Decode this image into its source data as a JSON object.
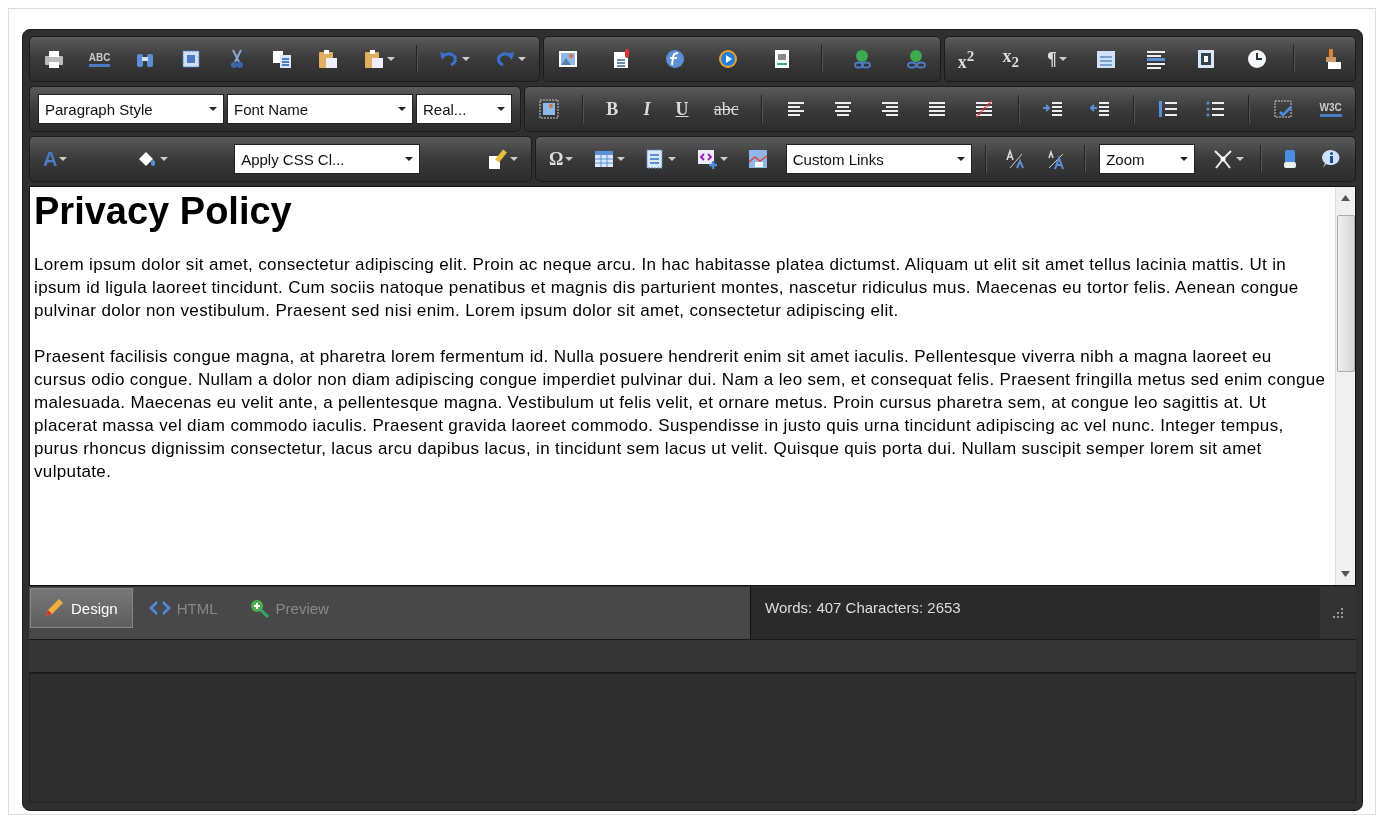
{
  "toolbars": [
    [
      [
        {
          "kind": "icon",
          "menu": false
        },
        {
          "kind": "glyph",
          "text": "ABC",
          "menu": false
        },
        {
          "kind": "icon",
          "menu": false
        },
        {
          "kind": "icon",
          "menu": false
        },
        {
          "kind": "icon",
          "menu": false
        },
        {
          "kind": "icon",
          "menu": false
        },
        {
          "kind": "icon",
          "menu": false
        },
        {
          "kind": "icon",
          "menu": true
        },
        {
          "kind": "sep"
        },
        {
          "kind": "icon",
          "menu": true
        },
        {
          "kind": "icon",
          "menu": true
        }
      ],
      [
        {
          "kind": "icon",
          "menu": false
        },
        {
          "kind": "icon",
          "menu": false
        },
        {
          "kind": "icon",
          "menu": false
        },
        {
          "kind": "icon",
          "menu": false
        },
        {
          "kind": "icon",
          "menu": false
        },
        {
          "kind": "sep"
        },
        {
          "kind": "icon",
          "menu": false
        },
        {
          "kind": "icon",
          "menu": false
        }
      ],
      [
        {
          "kind": "glyph",
          "text": "x$^{2}$",
          "menu": false
        },
        {
          "kind": "glyph",
          "text": "x$_{2}$",
          "menu": false
        },
        {
          "kind": "glyph",
          "text": "¶",
          "menu": true
        },
        {
          "kind": "icon",
          "menu": false
        },
        {
          "kind": "icon",
          "menu": false
        },
        {
          "kind": "icon",
          "menu": false
        },
        {
          "kind": "icon",
          "menu": false
        },
        {
          "kind": "sep"
        },
        {
          "kind": "icon",
          "menu": false
        }
      ]
    ],
    [
      [
        {
          "kind": "dropdown",
          "value": "Paragraph Style"
        },
        {
          "kind": "dropdown",
          "value": "Font Name"
        },
        {
          "kind": "dropdown",
          "value": "Real..."
        }
      ],
      [
        {
          "kind": "icon",
          "menu": false
        },
        {
          "kind": "sep"
        },
        {
          "kind": "glyph",
          "text": "B",
          "menu": false
        },
        {
          "kind": "glyph",
          "text": "I",
          "menu": false
        },
        {
          "kind": "glyph",
          "text": "U",
          "menu": false
        },
        {
          "kind": "glyph",
          "text": "abc",
          "menu": false
        },
        {
          "kind": "sep"
        },
        {
          "kind": "icon",
          "menu": false
        },
        {
          "kind": "icon",
          "menu": false
        },
        {
          "kind": "icon",
          "menu": false
        },
        {
          "kind": "icon",
          "menu": false
        },
        {
          "kind": "icon",
          "menu": false
        },
        {
          "kind": "sep"
        },
        {
          "kind": "icon",
          "menu": false
        },
        {
          "kind": "icon",
          "menu": false
        },
        {
          "kind": "sep"
        },
        {
          "kind": "icon",
          "menu": false
        },
        {
          "kind": "icon",
          "menu": false
        },
        {
          "kind": "sep"
        },
        {
          "kind": "icon",
          "menu": false
        },
        {
          "kind": "glyph",
          "text": "W3C",
          "menu": false
        }
      ]
    ],
    [
      [
        {
          "kind": "glyph",
          "text": "A",
          "menu": true
        },
        {
          "kind": "icon",
          "menu": true
        },
        {
          "kind": "dropdown",
          "value": "Apply CSS Cl..."
        },
        {
          "kind": "icon",
          "menu": true
        }
      ],
      [
        {
          "kind": "glyph",
          "text": "Ω",
          "menu": true
        },
        {
          "kind": "icon",
          "menu": true
        },
        {
          "kind": "icon",
          "menu": true
        },
        {
          "kind": "icon",
          "menu": true
        },
        {
          "kind": "icon",
          "menu": false
        },
        {
          "kind": "dropdown",
          "value": "Custom Links"
        },
        {
          "kind": "sep"
        },
        {
          "kind": "icon",
          "menu": false
        },
        {
          "kind": "icon",
          "menu": false
        },
        {
          "kind": "sep"
        },
        {
          "kind": "dropdown",
          "value": "Zoom"
        },
        {
          "kind": "icon",
          "menu": true
        },
        {
          "kind": "sep"
        },
        {
          "kind": "icon",
          "menu": false
        },
        {
          "kind": "icon",
          "menu": false
        }
      ]
    ]
  ],
  "document": {
    "heading": "Privacy Policy",
    "paragraphs": [
      "Lorem ipsum dolor sit amet, consectetur adipiscing elit. Proin ac neque arcu. In hac habitasse platea dictumst. Aliquam ut elit sit amet tellus lacinia mattis. Ut in ipsum id ligula laoreet tincidunt. Cum sociis natoque penatibus et magnis dis parturient montes, nascetur ridiculus mus. Maecenas eu tortor felis. Aenean congue pulvinar dolor non vestibulum. Praesent sed nisi enim. Lorem ipsum dolor sit amet, consectetur adipiscing elit.",
      "Praesent facilisis congue magna, at pharetra lorem fermentum id. Nulla posuere hendrerit enim sit amet iaculis. Pellentesque viverra nibh a magna laoreet eu cursus odio congue. Nullam a dolor non diam adipiscing congue imperdiet pulvinar dui. Nam a leo sem, et consequat felis. Praesent fringilla metus sed enim congue malesuada. Maecenas eu velit ante, a pellentesque magna. Vestibulum ut felis velit, et ornare metus. Proin cursus pharetra sem, at congue leo sagittis at. Ut placerat massa vel diam commodo iaculis. Praesent gravida laoreet commodo. Suspendisse in justo quis urna tincidunt adipiscing ac vel nunc. Integer tempus, purus rhoncus dignissim consectetur, lacus arcu dapibus lacus, in tincidunt sem lacus ut velit. Quisque quis porta dui. Nullam suscipit semper lorem sit amet vulputate."
    ]
  },
  "mode_tabs": [
    {
      "label": "Design",
      "selected": true
    },
    {
      "label": "HTML",
      "selected": false
    },
    {
      "label": "Preview",
      "selected": false
    }
  ],
  "status": "Words: 407 Characters: 2653"
}
